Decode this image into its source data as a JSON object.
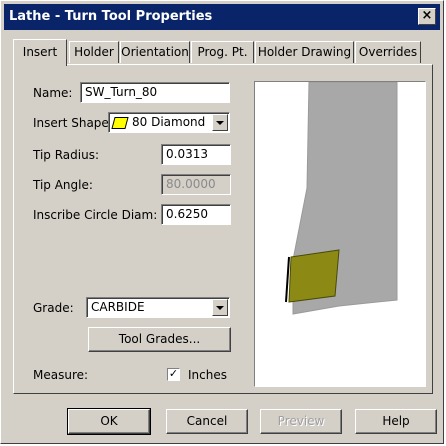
{
  "window": {
    "title": "Lathe - Turn Tool Properties",
    "close_glyph": "×"
  },
  "tabs": [
    {
      "label": "Insert"
    },
    {
      "label": "Holder"
    },
    {
      "label": "Orientation"
    },
    {
      "label": "Prog. Pt."
    },
    {
      "label": "Holder Drawing"
    },
    {
      "label": "Overrides"
    }
  ],
  "form": {
    "name_label": "Name:",
    "name_value": "SW_Turn_80",
    "insert_shape_label": "Insert Shape:",
    "insert_shape_value": "80 Diamond",
    "tip_radius_label": "Tip Radius:",
    "tip_radius_value": "0.0313",
    "tip_angle_label": "Tip Angle:",
    "tip_angle_value": "80.0000",
    "inscribe_label": "Inscribe Circle Diam:",
    "inscribe_value": "0.6250",
    "grade_label": "Grade:",
    "grade_value": "CARBIDE",
    "tool_grades_label": "Tool Grades...",
    "measure_label": "Measure:",
    "inches_label": "Inches",
    "inches_checked": true,
    "check_glyph": "✓"
  },
  "footer": {
    "ok_label": "OK",
    "cancel_label": "Cancel",
    "preview_label": "Preview",
    "help_label": "Help"
  },
  "colors": {
    "titlebar": "#0a246a",
    "insert_fill": "#8c8a14",
    "holder_fill": "#a8a8a8",
    "swatch": "#ffff00"
  }
}
